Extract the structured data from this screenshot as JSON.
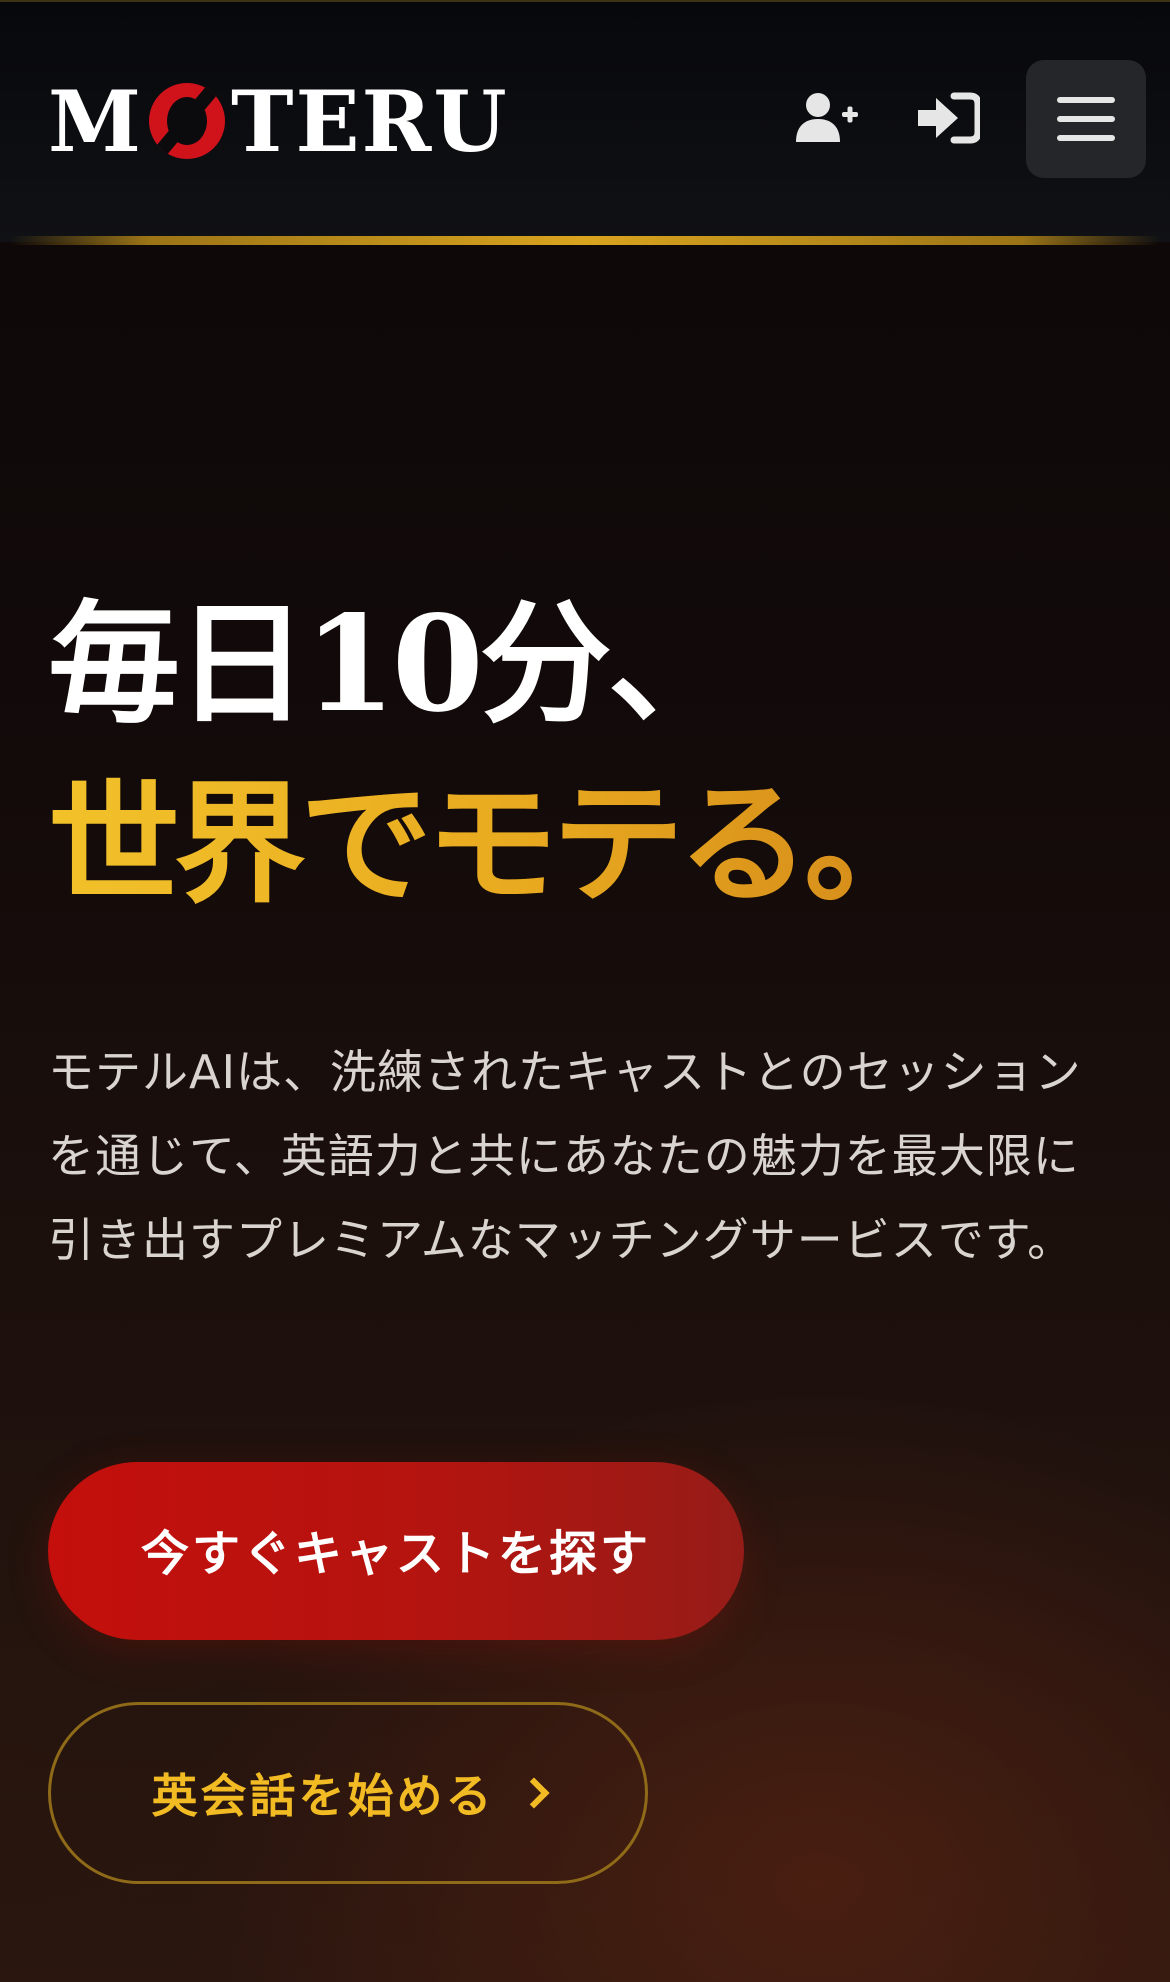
{
  "header": {
    "logo_text": "MOTERU",
    "logo_parts": {
      "m": "M",
      "rest": "TERU"
    },
    "icons": {
      "register": "user-plus-icon",
      "login": "sign-in-icon",
      "menu": "hamburger-menu-icon"
    }
  },
  "hero": {
    "headline_line1": "毎日10分、",
    "headline_line2": "世界でモテる。",
    "description": "モテルAIは、洗練されたキャストとのセッションを通じて、英語力と共にあなたの魅力を最大限に引き出すプレミアムなマッチングサービスです。",
    "primary_cta": "今すぐキャストを探す",
    "secondary_cta": "英会話を始める"
  },
  "colors": {
    "accent_gold": "#f2bb23",
    "accent_red": "#c40f0c",
    "logo_red": "#d0121b",
    "background_dark": "#0c0708"
  }
}
